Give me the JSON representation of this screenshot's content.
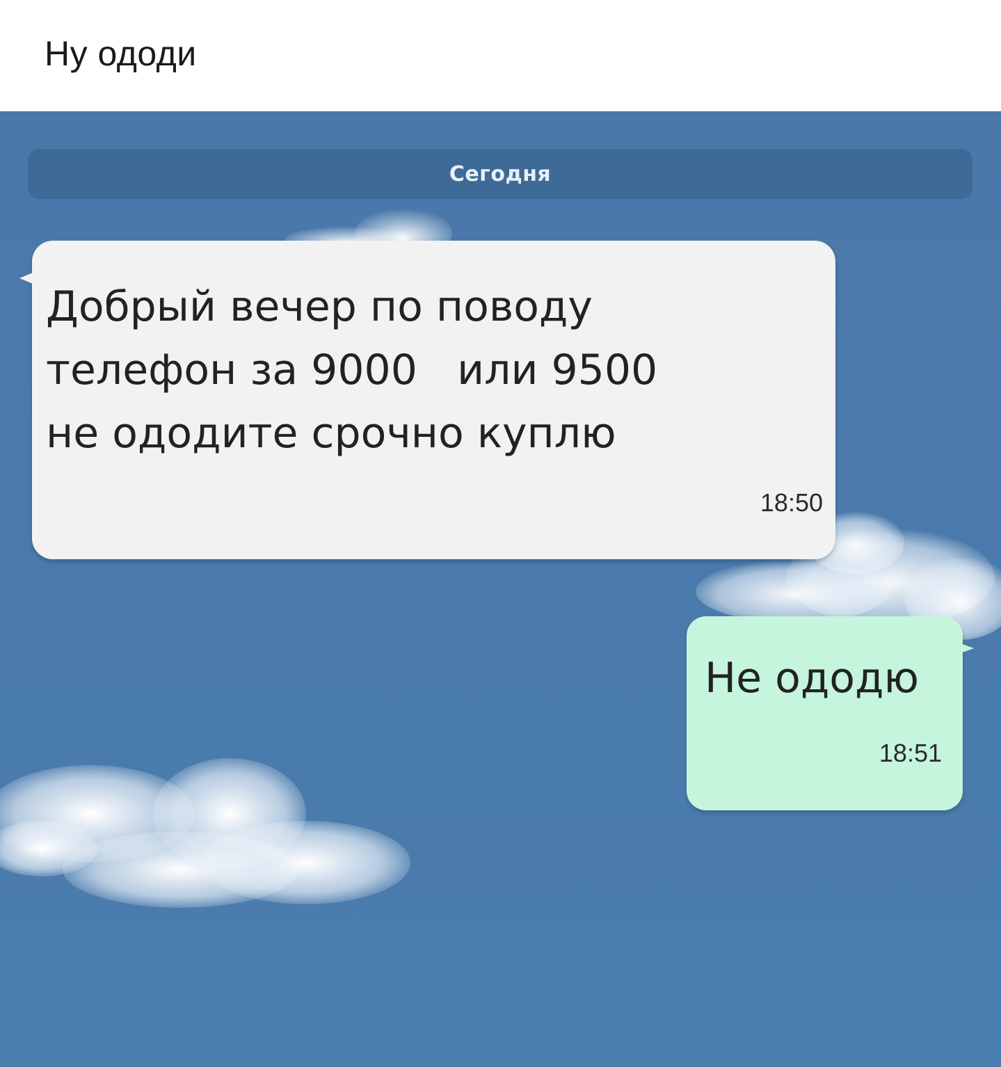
{
  "post": {
    "caption": "Ну ододи"
  },
  "chat": {
    "date_separator": "Сегодня",
    "background_color": "#4a7aac",
    "messages": [
      {
        "direction": "incoming",
        "text": "Добрый вечер по поводу\nтелефон за 9000   или 9500\nне ододите срочно куплю",
        "time": "18:50",
        "bubble_color": "#f2f2f2"
      },
      {
        "direction": "outgoing",
        "text": "Не ододю",
        "time": "18:51",
        "bubble_color": "#c5f5dc"
      }
    ]
  }
}
